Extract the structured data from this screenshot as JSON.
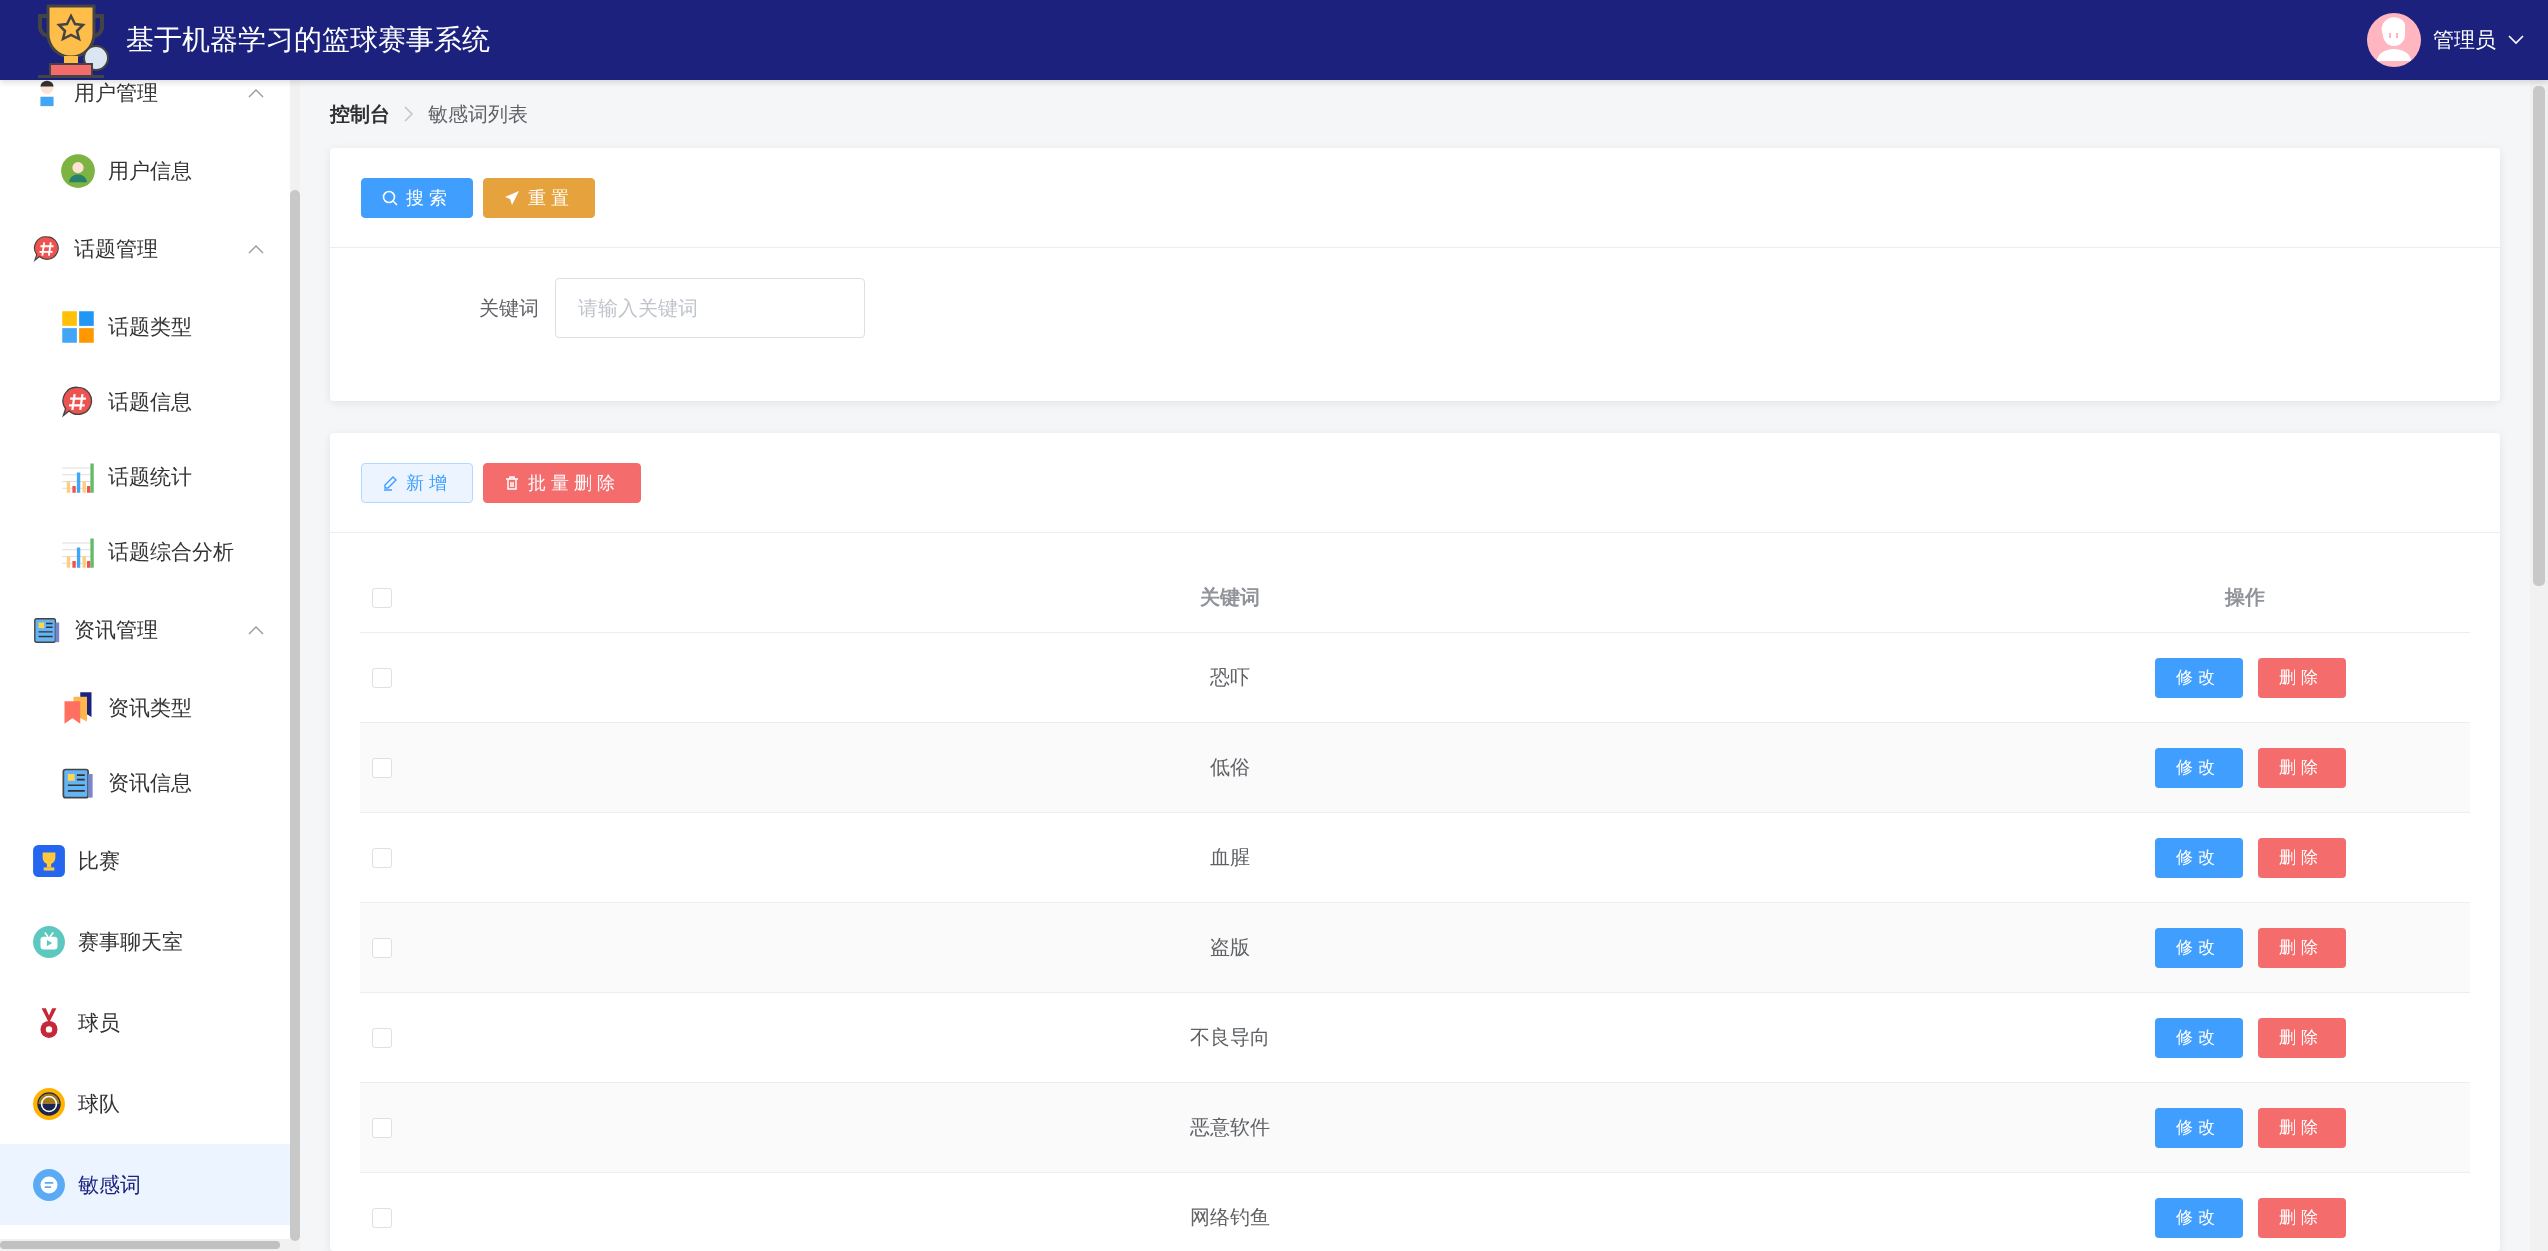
{
  "header": {
    "title": "基于机器学习的篮球赛事系统",
    "user": {
      "name": "管理员"
    }
  },
  "sidebar": {
    "items": [
      {
        "label": "用户管理",
        "expanded": true,
        "selected": false,
        "children": [
          {
            "label": "用户信息",
            "selected": false
          }
        ]
      },
      {
        "label": "话题管理",
        "expanded": true,
        "selected": false,
        "children": [
          {
            "label": "话题类型",
            "selected": false
          },
          {
            "label": "话题信息",
            "selected": false
          },
          {
            "label": "话题统计",
            "selected": false
          },
          {
            "label": "话题综合分析",
            "selected": false
          }
        ]
      },
      {
        "label": "资讯管理",
        "expanded": true,
        "selected": false,
        "children": [
          {
            "label": "资讯类型",
            "selected": false
          },
          {
            "label": "资讯信息",
            "selected": false
          }
        ]
      },
      {
        "label": "比赛",
        "selected": false
      },
      {
        "label": "赛事聊天室",
        "selected": false
      },
      {
        "label": "球员",
        "selected": false
      },
      {
        "label": "球队",
        "selected": false
      },
      {
        "label": "敏感词",
        "selected": true
      }
    ]
  },
  "breadcrumb": [
    "控制台",
    "敏感词列表"
  ],
  "search_panel": {
    "buttons": [
      {
        "label": "搜索",
        "kind": "search"
      },
      {
        "label": "重置",
        "kind": "reset"
      }
    ],
    "field": {
      "label": "关键词",
      "placeholder": "请输入关键词"
    }
  },
  "list_panel": {
    "buttons": [
      {
        "label": "新增",
        "kind": "add"
      },
      {
        "label": "批量删除",
        "kind": "batch_delete"
      }
    ],
    "table": {
      "select_all_checked": false,
      "columns": [
        "关键词",
        "操作"
      ],
      "rows": [
        {
          "checked": false,
          "keyword": "恐吓",
          "actions": [
            {
              "label": "修改",
              "kind": "edit"
            },
            {
              "label": "删除",
              "kind": "delete"
            }
          ]
        },
        {
          "checked": false,
          "keyword": "低俗",
          "actions": [
            {
              "label": "修改",
              "kind": "edit"
            },
            {
              "label": "删除",
              "kind": "delete"
            }
          ]
        },
        {
          "checked": false,
          "keyword": "血腥",
          "actions": [
            {
              "label": "修改",
              "kind": "edit"
            },
            {
              "label": "删除",
              "kind": "delete"
            }
          ]
        },
        {
          "checked": false,
          "keyword": "盗版",
          "actions": [
            {
              "label": "修改",
              "kind": "edit"
            },
            {
              "label": "删除",
              "kind": "delete"
            }
          ]
        },
        {
          "checked": false,
          "keyword": "不良导向",
          "actions": [
            {
              "label": "修改",
              "kind": "edit"
            },
            {
              "label": "删除",
              "kind": "delete"
            }
          ]
        },
        {
          "checked": false,
          "keyword": "恶意软件",
          "actions": [
            {
              "label": "修改",
              "kind": "edit"
            },
            {
              "label": "删除",
              "kind": "delete"
            }
          ]
        },
        {
          "checked": false,
          "keyword": "网络钓鱼",
          "actions": [
            {
              "label": "修改",
              "kind": "edit"
            },
            {
              "label": "删除",
              "kind": "delete"
            }
          ]
        }
      ]
    }
  }
}
